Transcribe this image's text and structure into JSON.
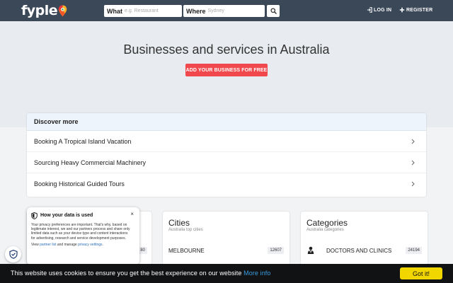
{
  "header": {
    "logo_text": "fyple",
    "search_what_label": "What",
    "search_what_placeholder": "e.g. Restaurant",
    "search_where_label": "Where",
    "search_where_placeholder": "Sydney",
    "login_label": "LOG IN",
    "register_label": "REGISTER"
  },
  "hero": {
    "title": "Businesses and services in Australia",
    "cta_label": "ADD YOUR BUSINESS FOR FREE"
  },
  "discover": {
    "title": "Discover more",
    "items": [
      {
        "label": "Booking A Tropical Island Vacation"
      },
      {
        "label": "Sourcing Heavy Commercial Machinery"
      },
      {
        "label": "Booking Historical Guided Tours"
      }
    ]
  },
  "cards": {
    "left": {
      "badge": "80"
    },
    "cities": {
      "title": "Cities",
      "subtitle": "Australia top cities",
      "row_label": "MELBOURNE",
      "row_count": "12607"
    },
    "categories": {
      "title": "Categories",
      "subtitle": "Australia categories",
      "row_label": "DOCTORS AND CLINICS",
      "row_count": "24194"
    }
  },
  "privacy": {
    "title": "How your data is used",
    "close_label": "×",
    "body": "Your privacy preferences are important. That's why, based on legitimate interest, we and our partners process and share only limited data such as your device type and content interactions for advertising, research and service development purposes.",
    "foot_prefix": "View",
    "partner_link": "partner list",
    "foot_middle": "and manage",
    "settings_link": "privacy settings",
    "foot_suffix": "."
  },
  "cookie": {
    "message": "This website uses cookies to ensure you get the best experience on our website",
    "more_info": "More info",
    "accept_label": "Got it!"
  },
  "colors": {
    "topbar": "#3b4858",
    "cta": "#f0484c",
    "cookie_button": "#f1d600",
    "link": "#3a9be0"
  }
}
